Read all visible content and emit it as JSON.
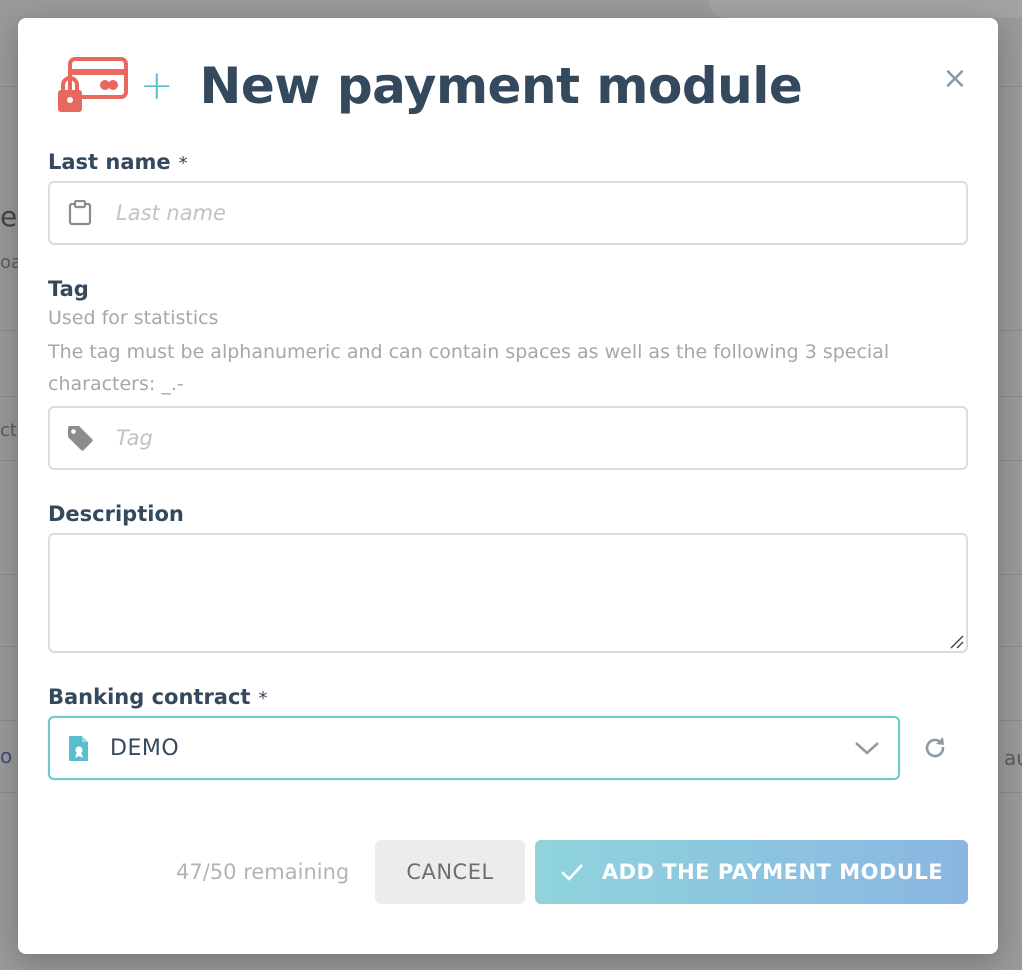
{
  "background": {
    "fragments": [
      "e",
      "oa",
      "ct.",
      "o",
      "au"
    ]
  },
  "modal": {
    "title": "New payment module",
    "icons": {
      "header_icon": "credit-card-lock-icon",
      "plus": "+",
      "close": "×"
    }
  },
  "form": {
    "last_name": {
      "label": "Last name",
      "required_mark": "*",
      "placeholder": "Last name",
      "value": "",
      "icon": "clipboard-icon"
    },
    "tag": {
      "label": "Tag",
      "help_1": "Used for statistics",
      "help_2": "The tag must be alphanumeric and can contain spaces as well as the following 3 special characters: _.-",
      "placeholder": "Tag",
      "value": "",
      "icon": "tag-icon"
    },
    "description": {
      "label": "Description",
      "value": ""
    },
    "banking_contract": {
      "label": "Banking contract",
      "required_mark": "*",
      "selected": "DEMO",
      "icon": "contract-document-icon"
    }
  },
  "footer": {
    "remaining": "47/50 remaining",
    "cancel_label": "CANCEL",
    "add_label": "ADD THE PAYMENT MODULE"
  },
  "colors": {
    "title": "#34495e",
    "accent_teal": "#5bbccc",
    "icon_red": "#e8675f",
    "button_gradient_start": "#8fd4dc",
    "button_gradient_end": "#8ab6e2"
  }
}
